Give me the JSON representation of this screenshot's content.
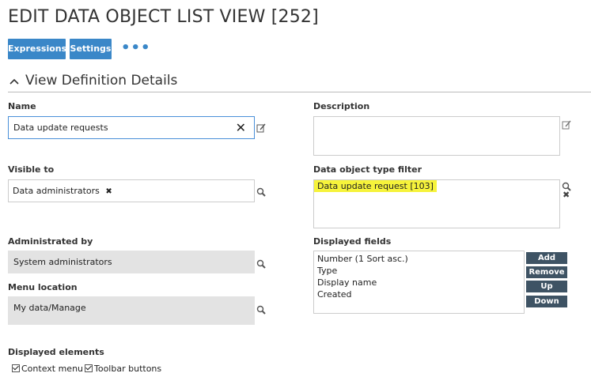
{
  "page": {
    "title": "EDIT DATA OBJECT LIST VIEW [252]"
  },
  "toolbar": {
    "expressions_label": "Expressions",
    "settings_label": "Settings",
    "more_label": "•••"
  },
  "section": {
    "title": "View Definition Details"
  },
  "name": {
    "label": "Name",
    "value": "Data update requests",
    "clear_glyph": "✕"
  },
  "description": {
    "label": "Description",
    "value": ""
  },
  "visible_to": {
    "label": "Visible to",
    "tag": "Data administrators",
    "remove_glyph": "✖"
  },
  "type_filter": {
    "label": "Data object type filter",
    "tag": "Data update request [103]",
    "remove_glyph": "✖"
  },
  "administrated_by": {
    "label": "Administrated by",
    "value": "System administrators"
  },
  "menu_location": {
    "label": "Menu location",
    "value": "My data/Manage"
  },
  "displayed_fields": {
    "label": "Displayed fields",
    "items": [
      "Number (1 Sort asc.)",
      "Type",
      "Display name",
      "Created"
    ],
    "buttons": {
      "add": "Add",
      "remove": "Remove",
      "up": "Up",
      "down": "Down"
    }
  },
  "displayed_elements": {
    "label": "Displayed elements",
    "options": [
      {
        "label": "Context menu",
        "checked": true
      },
      {
        "label": "Toolbar buttons",
        "checked": true
      }
    ]
  },
  "colors": {
    "accent": "#3a87c8",
    "dark_button": "#3e5364",
    "highlight": "#f6f33b",
    "readonly_bg": "#e3e3e3"
  }
}
